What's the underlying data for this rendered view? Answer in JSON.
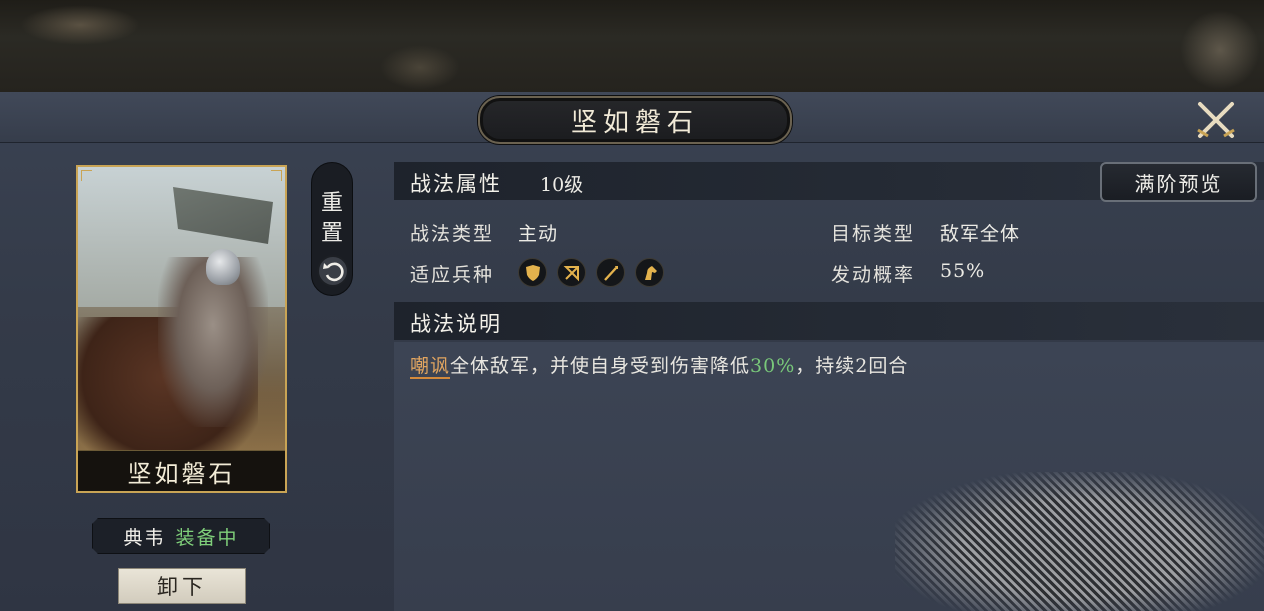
{
  "title": "坚如磐石",
  "card": {
    "name": "坚如磐石"
  },
  "reset": {
    "line1": "重",
    "line2": "置"
  },
  "attributes": {
    "header_label": "战法属性",
    "level": "10级",
    "preview_button": "满阶预览",
    "type_label": "战法类型",
    "type_value": "主动",
    "target_label": "目标类型",
    "target_value": "敌军全体",
    "troop_label": "适应兵种",
    "troop_icons": [
      "shield-icon",
      "bow-icon",
      "spear-icon",
      "horse-icon"
    ],
    "chance_label": "发动概率",
    "chance_value": "55%"
  },
  "description": {
    "header_label": "战法说明",
    "keyword": "嘲讽",
    "text_before": "全体敌军，并使自身受到伤害降低",
    "highlight": "30%",
    "text_after": "，持续2回合"
  },
  "general": {
    "name": "典韦",
    "status": "装备中"
  },
  "unequip_button": "卸下",
  "colors": {
    "gold": "#c9a455",
    "keyword": "#e1a560",
    "highlight_green": "#79c87a"
  }
}
